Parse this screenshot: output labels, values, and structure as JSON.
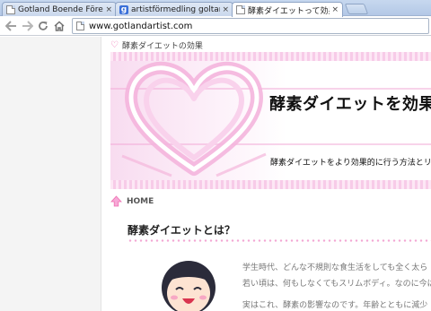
{
  "browser": {
    "tabs": [
      {
        "title": "Gotland Boende Företag Info",
        "icon": "page-icon",
        "active": false
      },
      {
        "title": "artistförmedling goltand - Sö",
        "icon": "google-icon",
        "active": false
      },
      {
        "title": "酵素ダイエットって効果あるの？",
        "icon": "page-icon",
        "active": true
      }
    ],
    "close_glyph": "×",
    "address": "www.gotlandartist.com"
  },
  "page": {
    "top_breadcrumb": "酵素ダイエットの効果",
    "banner": {
      "headline": "酵素ダイエットを効果",
      "subline": "酵素ダイエットをより効果的に行う方法とリバウンド"
    },
    "home_label": "HOME",
    "section_title": "酵素ダイエットとは？",
    "paragraph_lines": [
      "学生時代、どんな不規則な食生活をしても全く太ら",
      "若い頃は、何もしなくてもスリムボディ。なのに今は",
      "実はこれ、酵素の影響なのです。年齢とともに減少"
    ]
  },
  "colors": {
    "accent_pink": "#ee6fb1",
    "banner_pink": "#f7cbe8"
  }
}
